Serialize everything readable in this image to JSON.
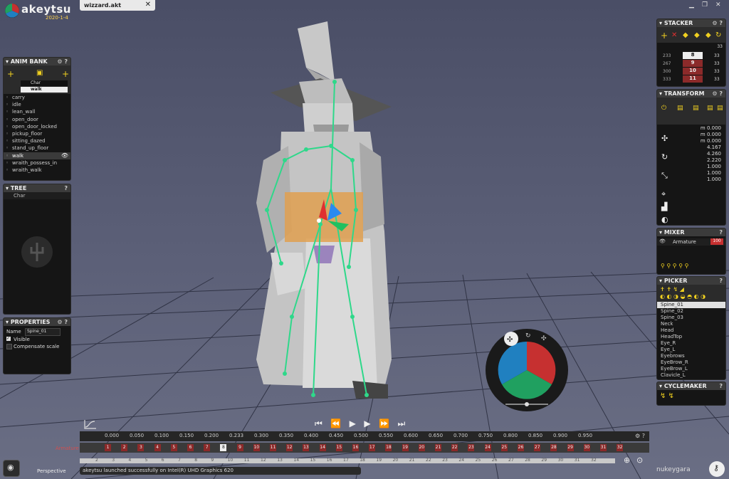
{
  "app": {
    "name": "akeytsu",
    "version": "2020-1-4",
    "file_tab": "wizzard.akt",
    "close_glyph": "✕"
  },
  "window_controls": [
    "▁",
    "❐",
    "✕"
  ],
  "anim_bank": {
    "title": "ANIM BANK",
    "char_label": "Char",
    "current": "walk",
    "items": [
      "carry",
      "idle",
      "lean_wall",
      "open_door",
      "open_door_locked",
      "pickup_floor",
      "sitting_dazed",
      "stand_up_floor",
      "walk",
      "wraith_possess_in",
      "wraith_walk"
    ],
    "selected": "walk"
  },
  "tree": {
    "title": "TREE",
    "root": "Char"
  },
  "properties": {
    "title": "PROPERTIES",
    "name_label": "Name",
    "name_value": "Spine_01",
    "visible_label": "Visible",
    "compensate_label": "Compensate scale"
  },
  "stacker": {
    "title": "STACKER",
    "field": "33",
    "rows": [
      {
        "frame": "233",
        "value": "8",
        "selected": true
      },
      {
        "frame": "267",
        "value": "9"
      },
      {
        "frame": "300",
        "value": "10"
      },
      {
        "frame": "333",
        "value": "11"
      }
    ],
    "side": [
      "33",
      "33",
      "33",
      "33"
    ]
  },
  "transform": {
    "title": "TRANSFORM",
    "values": [
      "m 0.000",
      "m 0.000",
      "m 0.000",
      "4.167",
      "4.260",
      "2.220",
      "1.000",
      "1.000",
      "1.000"
    ]
  },
  "mixer": {
    "title": "MIXER",
    "layer": "Armature",
    "layer_value": "100"
  },
  "picker": {
    "title": "PICKER",
    "bones": [
      "Spine_01",
      "Spine_02",
      "Spine_03",
      "Neck",
      "Head",
      "HeadTop",
      "Eye_R",
      "Eye_L",
      "Eyebrows",
      "EyeBrow_R",
      "EyeBrow_L",
      "Clavicle_L"
    ],
    "selected": "Spine_01"
  },
  "cyclemaker": {
    "title": "CYCLEMAKER"
  },
  "timeline": {
    "track_label": "Armature",
    "ticks": [
      "0.000",
      "0.050",
      "0.100",
      "0.150",
      "0.200",
      "0.233",
      "0.300",
      "0.350",
      "0.400",
      "0.450",
      "0.500",
      "0.550",
      "0.600",
      "0.650",
      "0.700",
      "0.750",
      "0.800",
      "0.850",
      "0.900",
      "0.950"
    ],
    "keys": [
      "1",
      "2",
      "3",
      "4",
      "5",
      "6",
      "7",
      "8",
      "9",
      "10",
      "11",
      "12",
      "13",
      "14",
      "15",
      "16",
      "17",
      "18",
      "19",
      "20",
      "21",
      "22",
      "23",
      "24",
      "25",
      "26",
      "27",
      "28",
      "29",
      "30",
      "31",
      "32"
    ],
    "current_key": "8",
    "scrub_ticks": [
      "2",
      "3",
      "4",
      "5",
      "6",
      "7",
      "8",
      "9",
      "10",
      "11",
      "12",
      "13",
      "14",
      "15",
      "16",
      "17",
      "18",
      "19",
      "20",
      "21",
      "22",
      "23",
      "24",
      "25",
      "26",
      "27",
      "28",
      "29",
      "30",
      "31",
      "32"
    ]
  },
  "viewport": {
    "mode": "Perspective"
  },
  "status_text": "akeytsu launched successfully on Intel(R) UHD Graphics 620",
  "brand": "nukeygara",
  "colors": {
    "accent_yellow": "#f0d020",
    "key_red": "#8c2a2a",
    "bone_green": "#2ed88a",
    "gizmo_red": "#c63030",
    "gizmo_green": "#20a060",
    "gizmo_blue": "#2080c0"
  }
}
